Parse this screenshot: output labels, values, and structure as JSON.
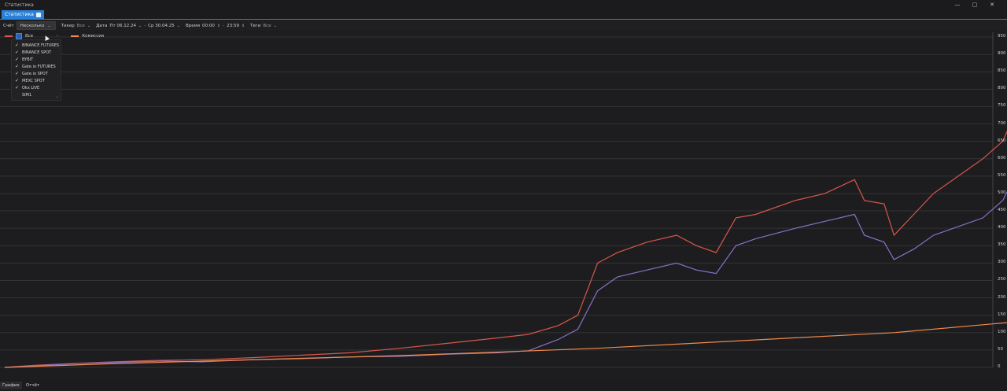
{
  "window": {
    "title": "Статистика",
    "controls": [
      "—",
      "▢",
      "✕"
    ]
  },
  "tab": {
    "label": "Статистика"
  },
  "toolbar": {
    "account_label": "Счёт",
    "account_value": "Несколько",
    "ticker_label": "Тикер",
    "ticker_value": "Все",
    "date_label": "Дата",
    "date_from": "Пт 06.12.24",
    "date_sep": "-",
    "date_to": "Ср 30.04.25",
    "time_label": "Время",
    "time_from": "00:00",
    "time_sep": "-",
    "time_to": "23:59",
    "tags_label": "Теги",
    "tags_value": "Все"
  },
  "legend": {
    "all_label": "Все",
    "commission_label": "Комиссия"
  },
  "dropdown": {
    "items": [
      {
        "label": "BINANCE FUTURES",
        "checked": true
      },
      {
        "label": "BINANCE SPOT",
        "checked": true
      },
      {
        "label": "BYBIT",
        "checked": true
      },
      {
        "label": "Gate.io FUTURES",
        "checked": true
      },
      {
        "label": "Gate.io SPOT",
        "checked": true
      },
      {
        "label": "MEXC SPOT",
        "checked": true
      },
      {
        "label": "Okx LIVE",
        "checked": true
      },
      {
        "label": "SIM1",
        "checked": false
      }
    ]
  },
  "colors": {
    "red_series": "#d8574a",
    "purple_series": "#8a6fc6",
    "orange_series": "#f08a4b",
    "accent": "#2a7fd6",
    "grid": "#333336"
  },
  "bottom_tabs": [
    "График",
    "Отчёт"
  ],
  "chart_data": {
    "type": "line",
    "y_ticks": [
      0,
      50,
      100,
      150,
      200,
      250,
      300,
      350,
      400,
      450,
      500,
      550,
      600,
      650,
      700,
      750,
      800,
      850,
      900,
      950
    ],
    "ylim": [
      0,
      950
    ],
    "xlim": [
      0,
      1000
    ],
    "grid": true,
    "series": [
      {
        "color_key": "red_series",
        "points": [
          [
            0,
            0
          ],
          [
            30,
            6
          ],
          [
            60,
            10
          ],
          [
            100,
            15
          ],
          [
            150,
            20
          ],
          [
            200,
            22
          ],
          [
            250,
            28
          ],
          [
            300,
            35
          ],
          [
            350,
            42
          ],
          [
            400,
            55
          ],
          [
            450,
            70
          ],
          [
            500,
            85
          ],
          [
            530,
            95
          ],
          [
            560,
            120
          ],
          [
            580,
            150
          ],
          [
            600,
            300
          ],
          [
            620,
            330
          ],
          [
            650,
            360
          ],
          [
            680,
            380
          ],
          [
            700,
            350
          ],
          [
            720,
            330
          ],
          [
            740,
            430
          ],
          [
            760,
            440
          ],
          [
            800,
            480
          ],
          [
            830,
            500
          ],
          [
            860,
            540
          ],
          [
            870,
            480
          ],
          [
            890,
            470
          ],
          [
            900,
            380
          ],
          [
            920,
            440
          ],
          [
            940,
            500
          ],
          [
            960,
            540
          ],
          [
            990,
            600
          ],
          [
            1010,
            650
          ],
          [
            1030,
            780
          ],
          [
            1050,
            850
          ],
          [
            1080,
            890
          ],
          [
            1100,
            910
          ],
          [
            1120,
            930
          ],
          [
            1140,
            900
          ],
          [
            1160,
            910
          ]
        ]
      },
      {
        "color_key": "purple_series",
        "points": [
          [
            0,
            0
          ],
          [
            40,
            6
          ],
          [
            80,
            12
          ],
          [
            120,
            15
          ],
          [
            160,
            18
          ],
          [
            200,
            16
          ],
          [
            250,
            22
          ],
          [
            300,
            25
          ],
          [
            350,
            30
          ],
          [
            400,
            32
          ],
          [
            450,
            38
          ],
          [
            500,
            42
          ],
          [
            530,
            48
          ],
          [
            560,
            80
          ],
          [
            580,
            110
          ],
          [
            600,
            220
          ],
          [
            620,
            260
          ],
          [
            650,
            280
          ],
          [
            680,
            300
          ],
          [
            700,
            280
          ],
          [
            720,
            270
          ],
          [
            740,
            350
          ],
          [
            760,
            370
          ],
          [
            800,
            400
          ],
          [
            830,
            420
          ],
          [
            860,
            440
          ],
          [
            870,
            380
          ],
          [
            890,
            360
          ],
          [
            900,
            310
          ],
          [
            920,
            340
          ],
          [
            940,
            380
          ],
          [
            960,
            400
          ],
          [
            990,
            430
          ],
          [
            1010,
            480
          ],
          [
            1030,
            590
          ],
          [
            1050,
            640
          ],
          [
            1080,
            680
          ],
          [
            1100,
            700
          ],
          [
            1120,
            740
          ],
          [
            1140,
            720
          ],
          [
            1160,
            730
          ]
        ]
      },
      {
        "color_key": "orange_series",
        "name": "Комиссия",
        "points": [
          [
            0,
            0
          ],
          [
            100,
            10
          ],
          [
            200,
            18
          ],
          [
            300,
            26
          ],
          [
            400,
            34
          ],
          [
            500,
            44
          ],
          [
            600,
            55
          ],
          [
            700,
            70
          ],
          [
            800,
            85
          ],
          [
            900,
            100
          ],
          [
            1000,
            125
          ],
          [
            1100,
            150
          ],
          [
            1160,
            175
          ]
        ]
      }
    ]
  }
}
